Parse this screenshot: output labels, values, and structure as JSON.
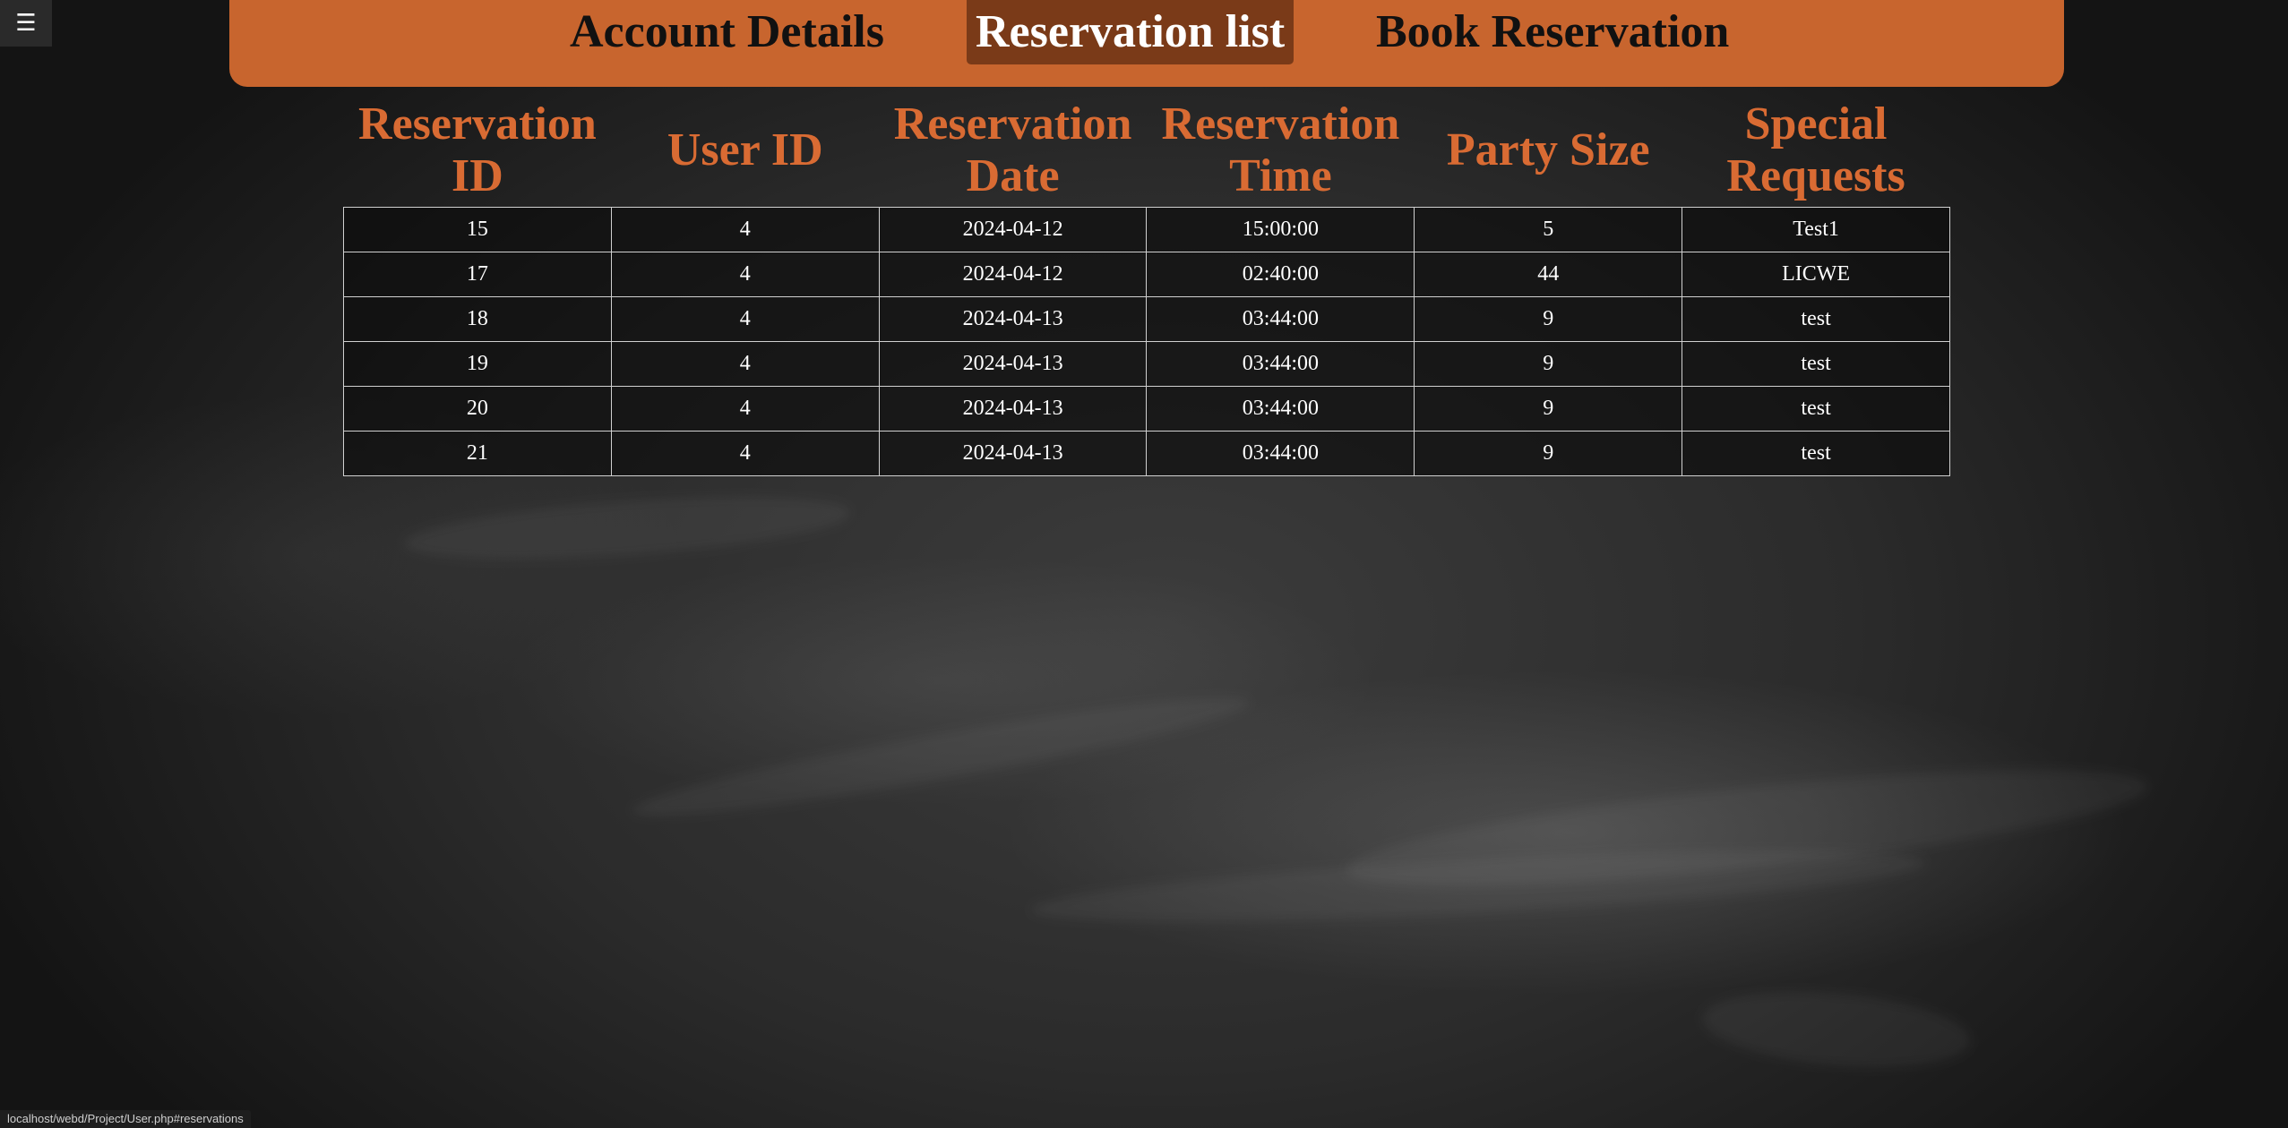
{
  "menu": {
    "icon": "hamburger-menu-icon",
    "glyph": "☰"
  },
  "nav": {
    "items": [
      {
        "label": "Account Details",
        "active": false
      },
      {
        "label": "Reservation list",
        "active": true
      },
      {
        "label": "Book Reservation",
        "active": false
      }
    ]
  },
  "colors": {
    "nav_background": "#c8652e",
    "nav_active_background": "#7a3a18",
    "header_text": "#d96b33",
    "cell_text": "#ffffff"
  },
  "table": {
    "columns": [
      "Reservation ID",
      "User ID",
      "Reservation Date",
      "Reservation Time",
      "Party Size",
      "Special Requests"
    ],
    "rows": [
      [
        "15",
        "4",
        "2024-04-12",
        "15:00:00",
        "5",
        "Test1"
      ],
      [
        "17",
        "4",
        "2024-04-12",
        "02:40:00",
        "44",
        "LICWE"
      ],
      [
        "18",
        "4",
        "2024-04-13",
        "03:44:00",
        "9",
        "test"
      ],
      [
        "19",
        "4",
        "2024-04-13",
        "03:44:00",
        "9",
        "test"
      ],
      [
        "20",
        "4",
        "2024-04-13",
        "03:44:00",
        "9",
        "test"
      ],
      [
        "21",
        "4",
        "2024-04-13",
        "03:44:00",
        "9",
        "test"
      ]
    ]
  },
  "status_bar": {
    "url": "localhost/webd/Project/User.php#reservations"
  }
}
